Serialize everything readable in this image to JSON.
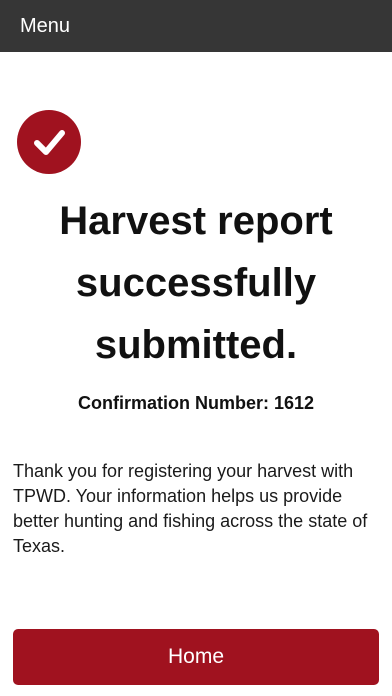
{
  "header": {
    "menu_label": "Menu"
  },
  "colors": {
    "header_bg": "#363636",
    "accent": "#a0121f"
  },
  "status_icon": "check-circle-icon",
  "title_lines": [
    "Harvest report",
    "successfully",
    "submitted."
  ],
  "confirmation": "Confirmation Number: 1612",
  "message": "Thank you for registering your harvest with TPWD. Your information helps us provide better hunting and fishing across the state of Texas.",
  "home_button_label": "Home"
}
